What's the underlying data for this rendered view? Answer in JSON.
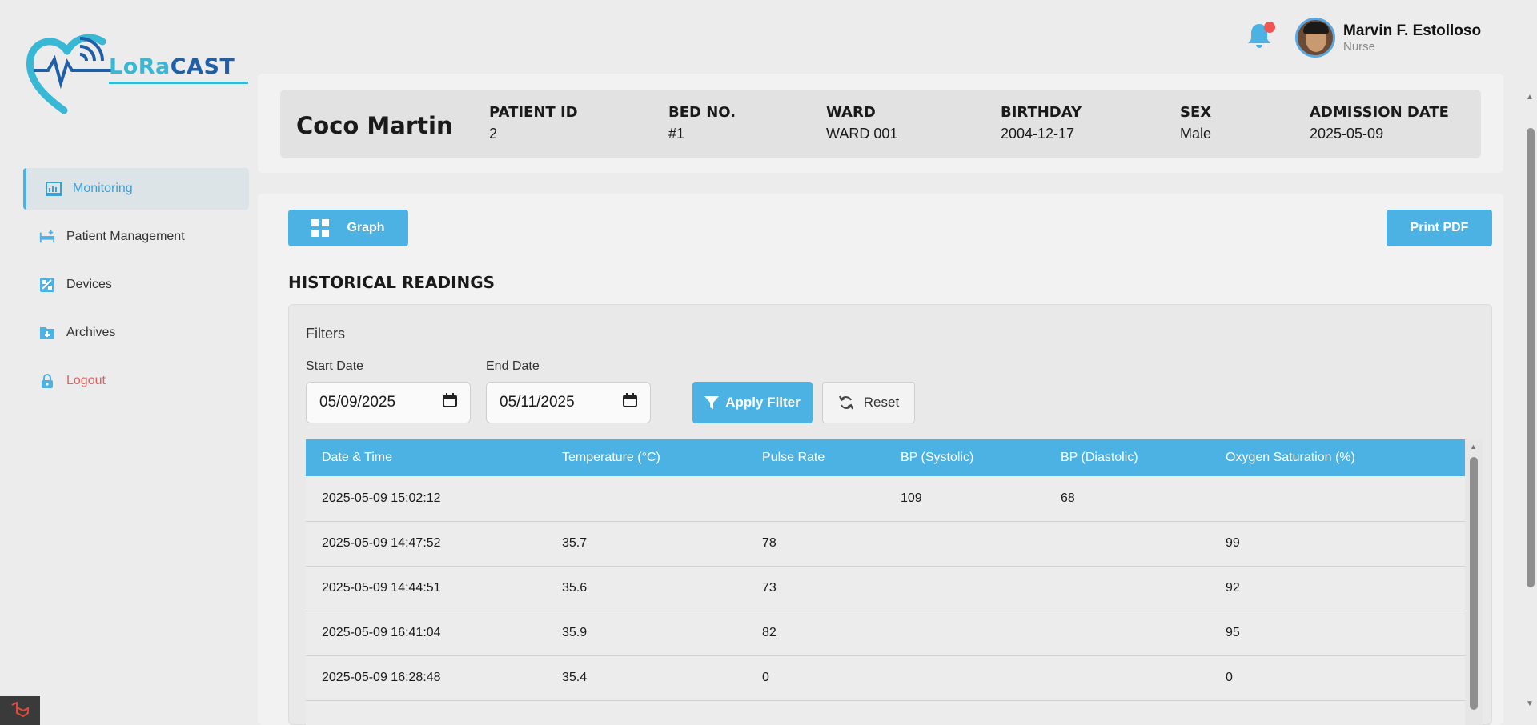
{
  "brand": {
    "logo_part1": "LoRa",
    "logo_part2": "CAST",
    "colors": {
      "primary": "#4cb2e3",
      "dark": "#1f5fa8",
      "logout": "#e06060"
    }
  },
  "sidebar": {
    "items": [
      {
        "label": "Monitoring",
        "icon": "monitor-chart-icon",
        "active": true
      },
      {
        "label": "Patient Management",
        "icon": "bed-plus-icon",
        "active": false
      },
      {
        "label": "Devices",
        "icon": "devices-icon",
        "active": false
      },
      {
        "label": "Archives",
        "icon": "archive-folder-icon",
        "active": false
      },
      {
        "label": "Logout",
        "icon": "lock-icon",
        "active": false
      }
    ]
  },
  "header": {
    "user_name": "Marvin F. Estolloso",
    "user_role": "Nurse"
  },
  "patient": {
    "name": "Coco Martin",
    "fields": [
      {
        "label": "PATIENT ID",
        "value": "2"
      },
      {
        "label": "BED NO.",
        "value": "#1"
      },
      {
        "label": "WARD",
        "value": "WARD 001"
      },
      {
        "label": "BIRTHDAY",
        "value": "2004-12-17"
      },
      {
        "label": "SEX",
        "value": "Male"
      },
      {
        "label": "ADMISSION DATE",
        "value": "2025-05-09"
      }
    ]
  },
  "toolbar": {
    "graph_label": "Graph",
    "print_label": "Print PDF"
  },
  "historical": {
    "title": "HISTORICAL READINGS",
    "filters_title": "Filters",
    "start_label": "Start Date",
    "start_value": "05/09/2025",
    "end_label": "End Date",
    "end_value": "05/11/2025",
    "apply_label": "Apply Filter",
    "reset_label": "Reset"
  },
  "table": {
    "columns": [
      "Date & Time",
      "Temperature (°C)",
      "Pulse Rate",
      "BP (Systolic)",
      "BP (Diastolic)",
      "Oxygen Saturation (%)"
    ],
    "rows": [
      [
        "2025-05-09 15:02:12",
        "",
        "",
        "109",
        "68",
        ""
      ],
      [
        "2025-05-09 14:47:52",
        "35.7",
        "78",
        "",
        "",
        "99"
      ],
      [
        "2025-05-09 14:44:51",
        "35.6",
        "73",
        "",
        "",
        "92"
      ],
      [
        "2025-05-09 16:41:04",
        "35.9",
        "82",
        "",
        "",
        "95"
      ],
      [
        "2025-05-09 16:28:48",
        "35.4",
        "0",
        "",
        "",
        "0"
      ],
      [
        "",
        "",
        "",
        "",
        "",
        ""
      ]
    ]
  }
}
